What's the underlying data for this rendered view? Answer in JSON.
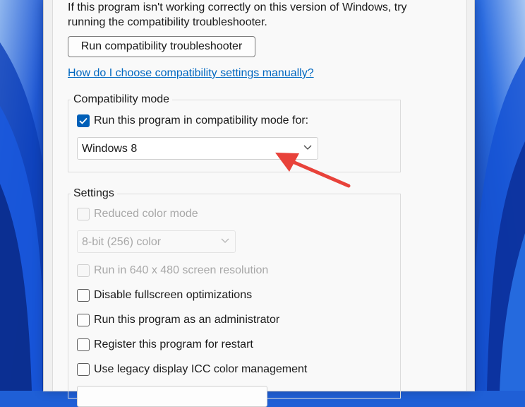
{
  "intro_text": {
    "line1": "If this program isn't working correctly on this version of Windows, try",
    "line2": "running the compatibility troubleshooter."
  },
  "troubleshooter_button": "Run compatibility troubleshooter",
  "manual_settings_link": "How do I choose compatibility settings manually?",
  "compat_mode": {
    "legend": "Compatibility mode",
    "checkbox_label": "Run this program in compatibility mode for:",
    "checked": true,
    "selected_os": "Windows 8"
  },
  "settings": {
    "legend": "Settings",
    "reduced_color": {
      "label": "Reduced color mode",
      "checked": false,
      "enabled": false
    },
    "color_depth": "8-bit (256) color",
    "resolution_640": {
      "label": "Run in 640 x 480 screen resolution",
      "checked": false,
      "enabled": false
    },
    "disable_fullscreen": {
      "label": "Disable fullscreen optimizations",
      "checked": false
    },
    "run_as_admin": {
      "label": "Run this program as an administrator",
      "checked": false
    },
    "register_restart": {
      "label": "Register this program for restart",
      "checked": false
    },
    "legacy_icc": {
      "label": "Use legacy display ICC color management",
      "checked": false
    }
  },
  "colors": {
    "accent": "#005fb8",
    "link": "#0067c0",
    "annotation_arrow": "#e8423a",
    "wallpaper": "#1f5fd6"
  }
}
